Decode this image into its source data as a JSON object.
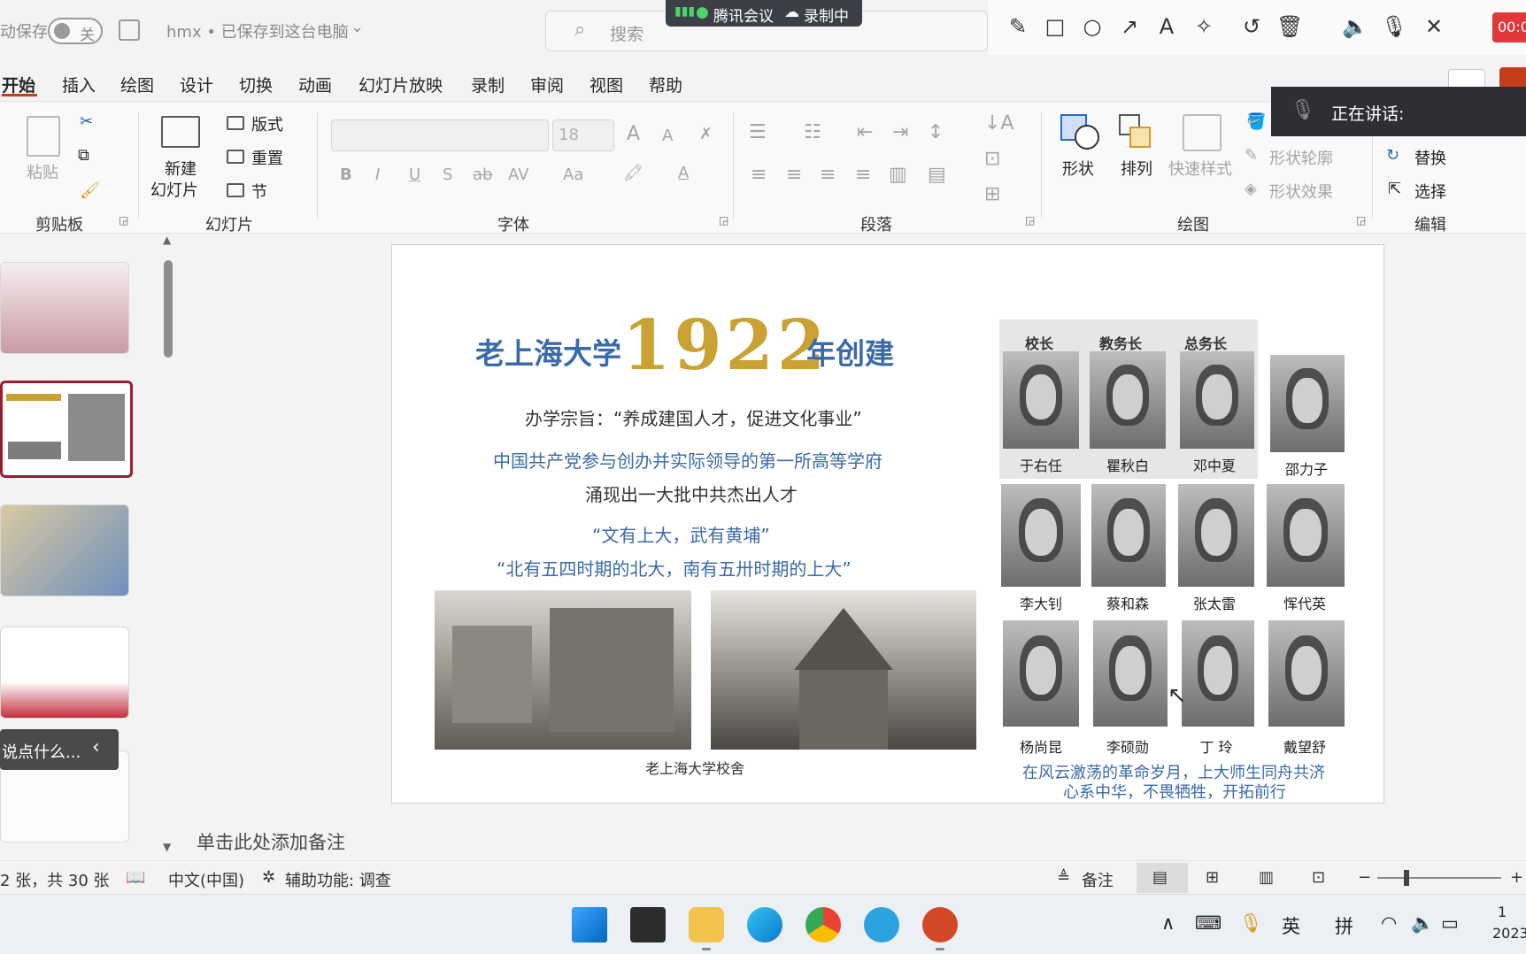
{
  "titlebar": {
    "autosave_label": "动保存",
    "autosave_state": "关",
    "doc_title": "hmx • 已保存到这台电脑",
    "search_placeholder": "搜索",
    "meeting_app": "腾讯会议",
    "recording": "录制中",
    "timer": "00:0"
  },
  "menu": [
    "开始",
    "插入",
    "绘图",
    "设计",
    "切换",
    "动画",
    "幻灯片放映",
    "录制",
    "审阅",
    "视图",
    "帮助"
  ],
  "speaking": {
    "label": "正在讲话:"
  },
  "ribbon": {
    "clipboard": {
      "paste": "粘贴",
      "group": "剪贴板"
    },
    "slides": {
      "new_slide_line1": "新建",
      "new_slide_line2": "幻灯片",
      "layout": "版式",
      "reset": "重置",
      "section": "节",
      "group": "幻灯片"
    },
    "font": {
      "size": "18",
      "bold": "B",
      "italic": "I",
      "underline": "U",
      "shadow": "S",
      "strike": "ab",
      "spacing": "AV",
      "case": "Aa",
      "grow": "A",
      "shrink": "A",
      "group": "字体"
    },
    "paragraph": {
      "group": "段落"
    },
    "drawing": {
      "shapes": "形状",
      "arrange": "排列",
      "quick_styles": "快速样式",
      "outline": "形状轮廓",
      "effects": "形状效果",
      "group": "绘图"
    },
    "editing": {
      "replace": "替换",
      "select": "选择",
      "group": "编辑"
    }
  },
  "thumbs": {
    "tooltip": "说点什么..."
  },
  "slide": {
    "title_prefix": "老上海大学",
    "title_year": "1922",
    "title_suffix": "年创建",
    "motto": "办学宗旨：“养成建国人才，促进文化事业”",
    "line1": "中国共产党参与创办并实际领导的第一所高等学府",
    "line2": "涌现出一大批中共杰出人才",
    "quote1": "“文有上大，武有黄埔”",
    "quote2": "“北有五四时期的北大，南有五卅时期的上大”",
    "photo_caption": "老上海大学校舍",
    "roles": [
      "校长",
      "教务长",
      "总务长"
    ],
    "people_row1": [
      "于右任",
      "瞿秋白",
      "邓中夏",
      "邵力子"
    ],
    "people_row2": [
      "李大钊",
      "蔡和森",
      "张太雷",
      "恽代英"
    ],
    "people_row3": [
      "杨尚昆",
      "李硕勋",
      "丁 玲",
      "戴望舒"
    ],
    "closing1": "在风云激荡的革命岁月，上大师生同舟共济",
    "closing2": "心系中华，不畏牺牲，开拓前行"
  },
  "notes": {
    "placeholder": "单击此处添加备注"
  },
  "status": {
    "slide_count": "2 张，共 30 张",
    "language": "中文(中国)",
    "accessibility": "辅助功能: 调查",
    "notes_btn": "备注"
  },
  "taskbar": {
    "ime1": "英",
    "ime2": "拼",
    "clock_line1": "1",
    "clock_line2": "2023"
  },
  "colors": {
    "accent": "#c43e1c",
    "slide_blue": "#3b6aa8",
    "gold": "#c9a233",
    "active_thumb": "#9b1c31"
  }
}
